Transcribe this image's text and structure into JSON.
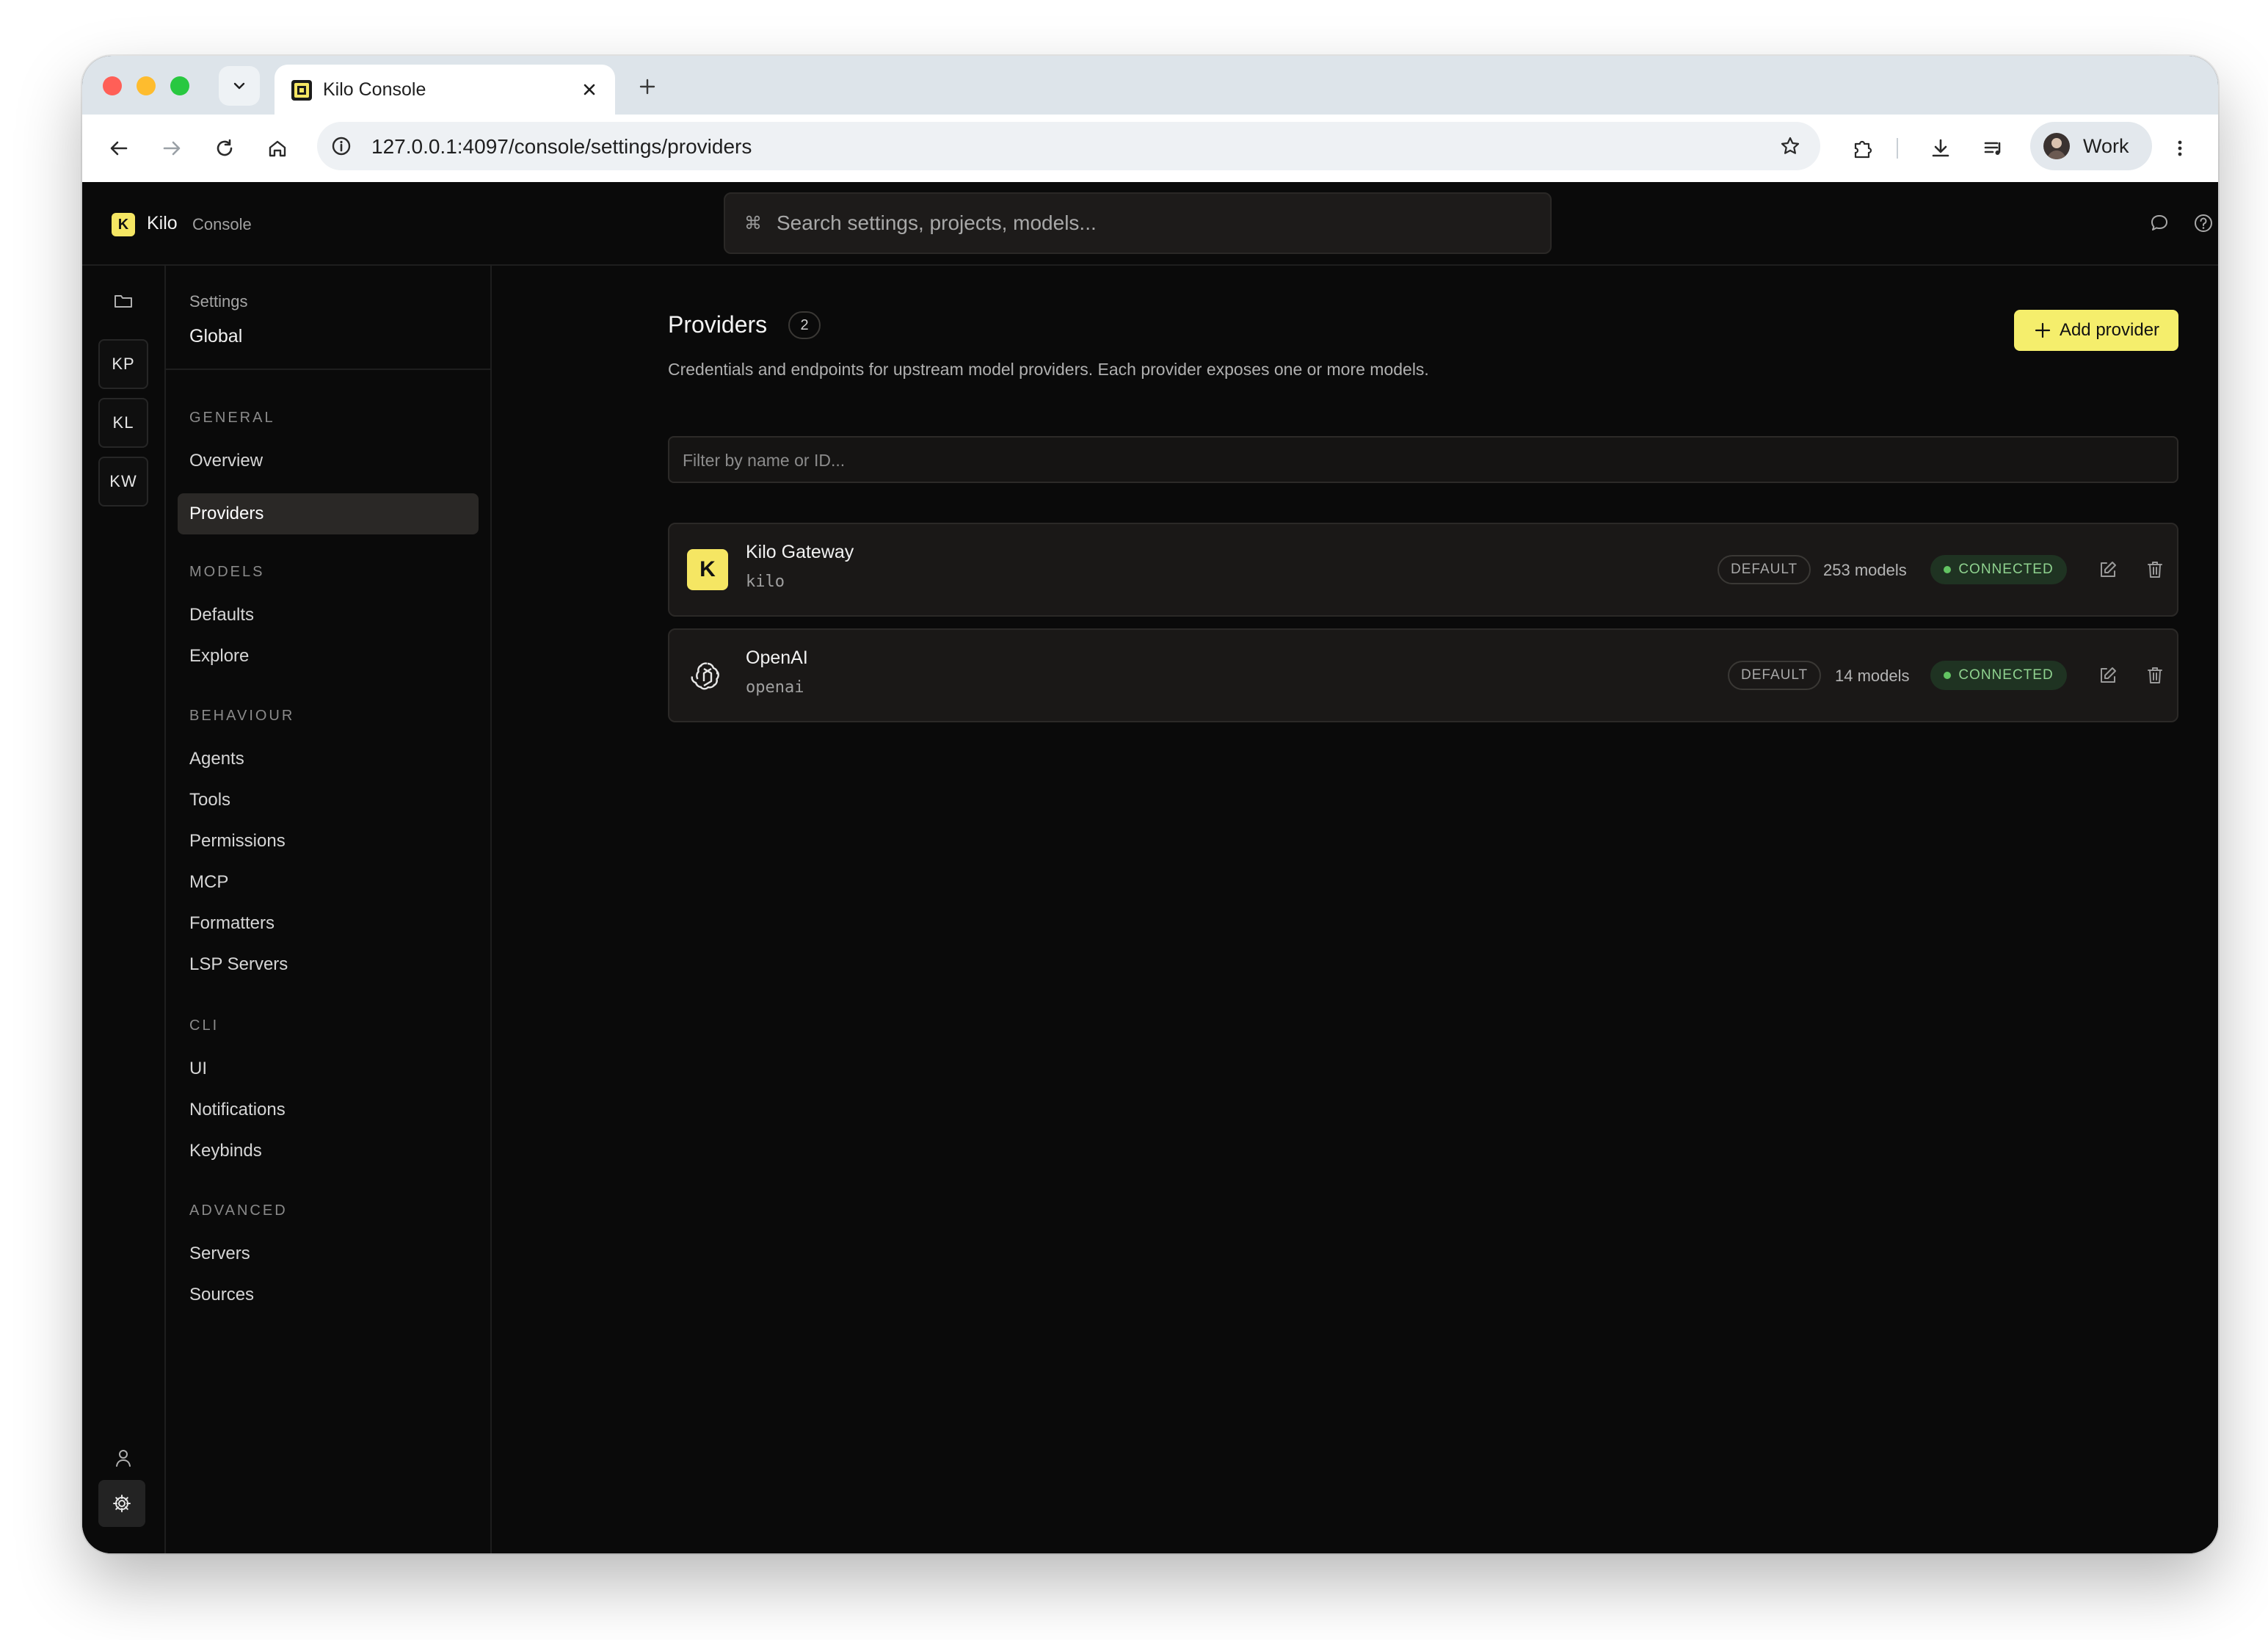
{
  "browser": {
    "tab_title": "Kilo Console",
    "url": "127.0.0.1:4097/console/settings/providers",
    "profile_label": "Work"
  },
  "app": {
    "brand_mark": "K",
    "brand_name": "Kilo",
    "brand_sub": "Console",
    "search_placeholder": "Search settings, projects, models...",
    "search_shortcut_icon": "⌘"
  },
  "rail": {
    "projects": [
      "KP",
      "KL",
      "KW"
    ]
  },
  "sidebar": {
    "caption": "Settings",
    "scope": "Global",
    "sections": {
      "general": "GENERAL",
      "models": "MODELS",
      "behaviour": "BEHAVIOUR",
      "cli": "CLI",
      "advanced": "ADVANCED"
    },
    "items": {
      "overview": "Overview",
      "providers": "Providers",
      "defaults": "Defaults",
      "explore": "Explore",
      "agents": "Agents",
      "tools": "Tools",
      "permissions": "Permissions",
      "mcp": "MCP",
      "formatters": "Formatters",
      "lsp_servers": "LSP Servers",
      "ui": "UI",
      "notifications": "Notifications",
      "keybinds": "Keybinds",
      "servers": "Servers",
      "sources": "Sources"
    },
    "active_item": "Providers"
  },
  "main": {
    "title": "Providers",
    "count": "2",
    "description": "Credentials and endpoints for upstream model providers. Each provider exposes one or more models.",
    "add_button": "Add provider",
    "filter_placeholder": "Filter by name or ID...",
    "providers": [
      {
        "logo": "K",
        "name": "Kilo Gateway",
        "id": "kilo",
        "default_label": "DEFAULT",
        "models": "253 models",
        "status": "CONNECTED"
      },
      {
        "logo": "openai-icon",
        "name": "OpenAI",
        "id": "openai",
        "default_label": "DEFAULT",
        "models": "14 models",
        "status": "CONNECTED"
      }
    ]
  },
  "colors": {
    "accent": "#f5ee6c",
    "background": "#0a0a0a",
    "card": "#1a1817",
    "connected_text": "#8fd28f",
    "connected_bg": "#1f3322"
  }
}
